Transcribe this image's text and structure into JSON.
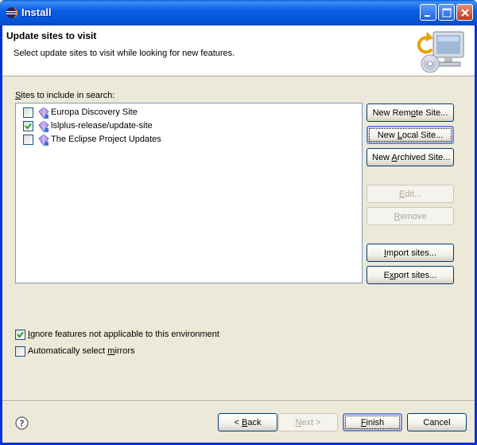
{
  "window": {
    "title": "Install"
  },
  "header": {
    "title": "Update sites to visit",
    "description": "Select update sites to visit while looking for new features."
  },
  "sites": {
    "label_prefix": "",
    "label_mnemonic": "S",
    "label_rest": "ites to include in search:",
    "items": [
      {
        "label": "Europa Discovery Site",
        "checked": false
      },
      {
        "label": "lslplus-release/update-site",
        "checked": true
      },
      {
        "label": "The Eclipse Project Updates",
        "checked": false
      }
    ]
  },
  "side_buttons": {
    "new_remote": {
      "pre": "New Rem",
      "mn": "o",
      "post": "te Site..."
    },
    "new_local": {
      "pre": "New ",
      "mn": "L",
      "post": "ocal Site..."
    },
    "new_archived": {
      "pre": "New ",
      "mn": "A",
      "post": "rchived Site..."
    },
    "edit": {
      "pre": "",
      "mn": "E",
      "post": "dit..."
    },
    "remove": {
      "pre": "",
      "mn": "R",
      "post": "emove"
    },
    "import": {
      "pre": "",
      "mn": "I",
      "post": "mport sites..."
    },
    "export": {
      "pre": "E",
      "mn": "x",
      "post": "port sites..."
    }
  },
  "options": {
    "ignore": {
      "pre": "",
      "mn": "I",
      "post": "gnore features not applicable to this environment",
      "checked": true
    },
    "mirrors": {
      "pre": "Automatically select ",
      "mn": "m",
      "post": "irrors",
      "checked": false
    }
  },
  "footer": {
    "back": {
      "pre": "< ",
      "mn": "B",
      "post": "ack"
    },
    "next": {
      "pre": "",
      "mn": "N",
      "post": "ext >"
    },
    "finish": {
      "pre": "",
      "mn": "F",
      "post": "inish"
    },
    "cancel": "Cancel"
  },
  "colors": {
    "titlebar": "#0a5fe6",
    "dialog_bg": "#ece9d8",
    "check": "#21a121"
  }
}
